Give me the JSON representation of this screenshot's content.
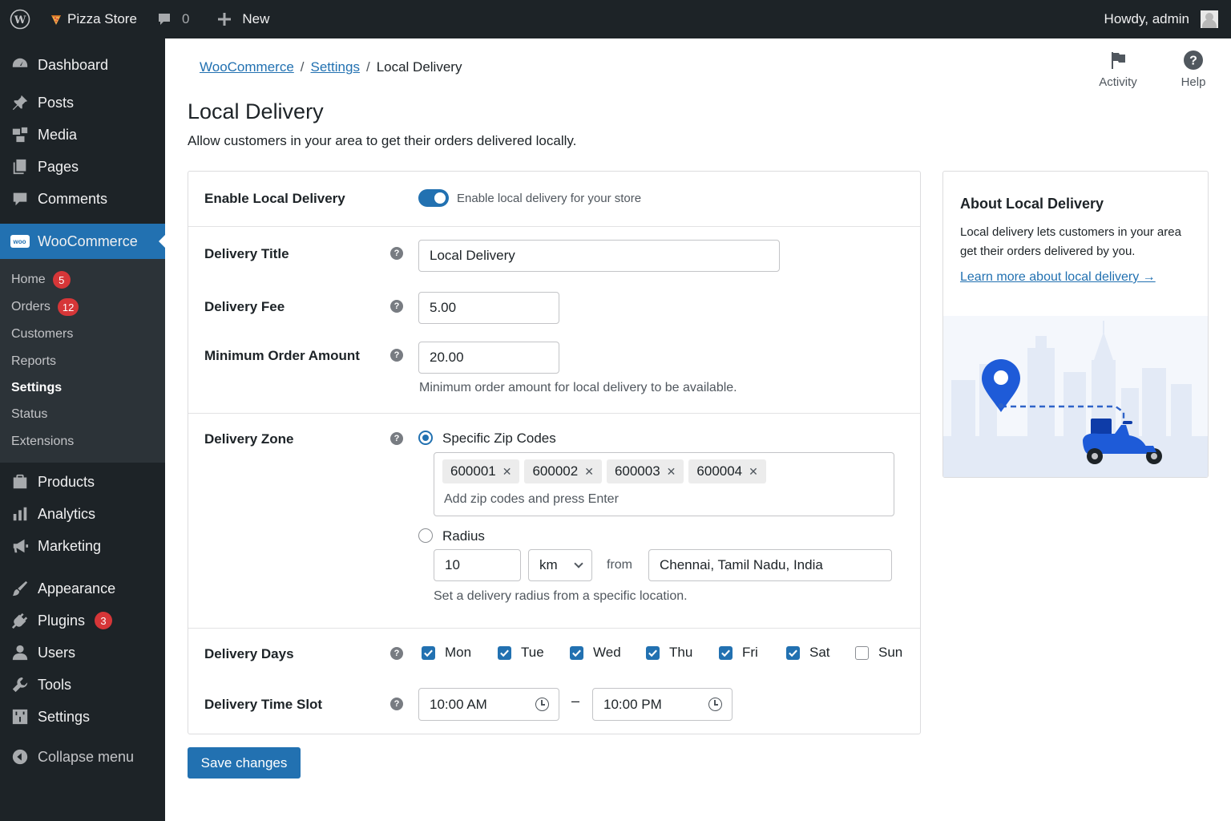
{
  "adminbar": {
    "site_name": "Pizza Store",
    "comments_count": "0",
    "new_label": "New",
    "howdy": "Howdy, admin"
  },
  "sidebar": {
    "dashboard": "Dashboard",
    "posts": "Posts",
    "media": "Media",
    "pages": "Pages",
    "comments": "Comments",
    "woocommerce": "WooCommerce",
    "woo_logo_text": "woo",
    "submenu": {
      "home": "Home",
      "home_badge": "5",
      "orders": "Orders",
      "orders_badge": "12",
      "customers": "Customers",
      "reports": "Reports",
      "settings": "Settings",
      "status": "Status",
      "extensions": "Extensions"
    },
    "products": "Products",
    "analytics": "Analytics",
    "marketing": "Marketing",
    "appearance": "Appearance",
    "plugins": "Plugins",
    "plugins_badge": "3",
    "users": "Users",
    "tools": "Tools",
    "settings": "Settings",
    "collapse": "Collapse menu"
  },
  "breadcrumb": {
    "woocommerce": "WooCommerce",
    "settings": "Settings",
    "current": "Local Delivery",
    "separator": "/"
  },
  "top_actions": {
    "activity": "Activity",
    "help": "Help"
  },
  "page": {
    "title": "Local Delivery",
    "description": "Allow customers in your area to get their orders delivered locally."
  },
  "form": {
    "enable": {
      "label": "Enable Local Delivery",
      "toggle_text": "Enable local delivery for your store",
      "enabled": true
    },
    "title": {
      "label": "Delivery Title",
      "value": "Local Delivery"
    },
    "fee": {
      "label": "Delivery Fee",
      "value": "5.00"
    },
    "min_order": {
      "label": "Minimum Order Amount",
      "value": "20.00",
      "hint": "Minimum order amount for local delivery to be available."
    },
    "zone": {
      "label": "Delivery Zone",
      "specific_label": "Specific Zip Codes",
      "zip_codes": [
        "600001",
        "600002",
        "600003",
        "600004"
      ],
      "zip_placeholder": "Add zip codes and press Enter",
      "radius_label": "Radius",
      "radius_value": "10",
      "radius_unit": "km",
      "from_label": "from",
      "location": "Chennai, Tamil Nadu, India",
      "radius_hint": "Set a delivery radius from a specific location."
    },
    "days": {
      "label": "Delivery Days",
      "items": [
        {
          "name": "Mon",
          "checked": true
        },
        {
          "name": "Tue",
          "checked": true
        },
        {
          "name": "Wed",
          "checked": true
        },
        {
          "name": "Thu",
          "checked": true
        },
        {
          "name": "Fri",
          "checked": true
        },
        {
          "name": "Sat",
          "checked": true
        },
        {
          "name": "Sun",
          "checked": false
        }
      ]
    },
    "time_slot": {
      "label": "Delivery Time Slot",
      "start": "10:00 AM",
      "end": "10:00 PM",
      "separator": "–"
    },
    "help_glyph": "?",
    "save_label": "Save changes"
  },
  "about": {
    "title": "About Local Delivery",
    "text": "Local delivery lets customers in your area get their orders delivered by you.",
    "link": "Learn more about local delivery →"
  },
  "colors": {
    "primary": "#2271b1",
    "adminbar": "#1d2327",
    "submenu_bg": "#2c3338",
    "badge": "#d63638"
  }
}
